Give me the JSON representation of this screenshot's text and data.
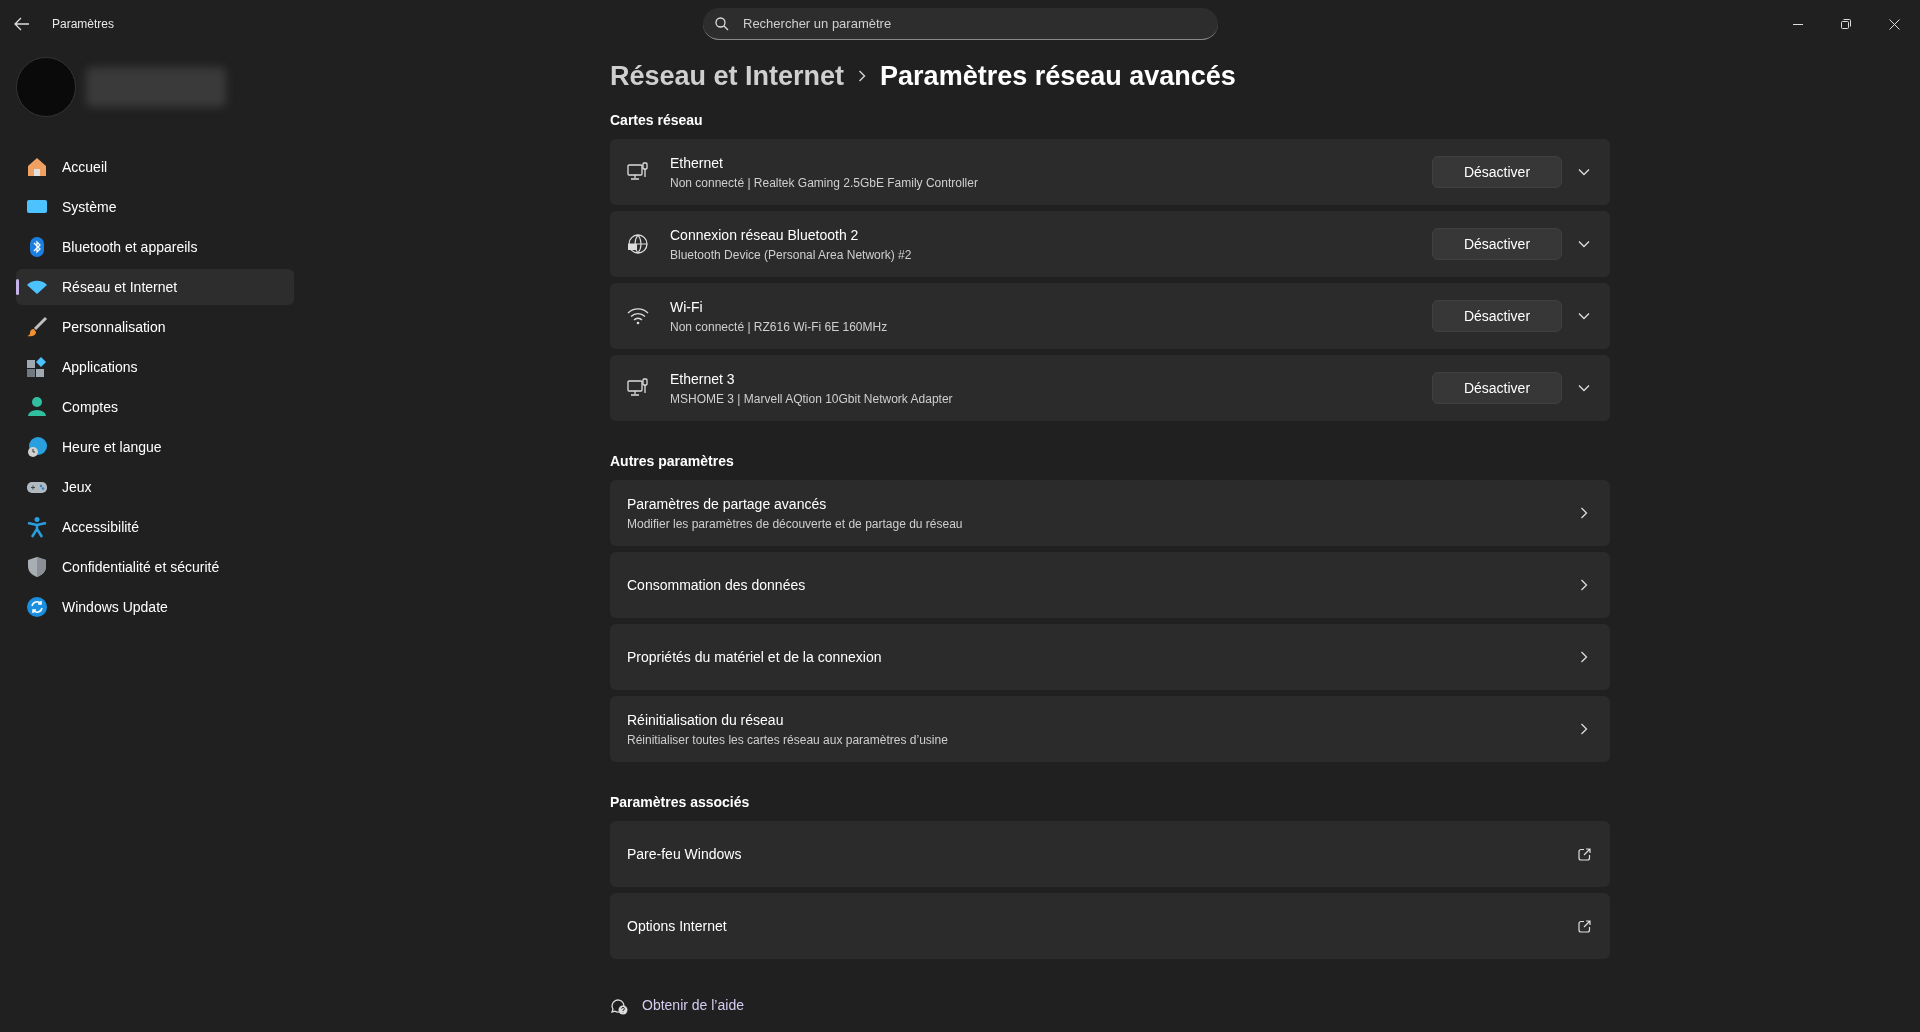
{
  "window": {
    "title": "Paramètres"
  },
  "search": {
    "placeholder": "Rechercher un paramètre"
  },
  "sidebar": {
    "items": [
      {
        "label": "Accueil",
        "selected": false
      },
      {
        "label": "Système",
        "selected": false
      },
      {
        "label": "Bluetooth et appareils",
        "selected": false
      },
      {
        "label": "Réseau et Internet",
        "selected": true
      },
      {
        "label": "Personnalisation",
        "selected": false
      },
      {
        "label": "Applications",
        "selected": false
      },
      {
        "label": "Comptes",
        "selected": false
      },
      {
        "label": "Heure et langue",
        "selected": false
      },
      {
        "label": "Jeux",
        "selected": false
      },
      {
        "label": "Accessibilité",
        "selected": false
      },
      {
        "label": "Confidentialité et sécurité",
        "selected": false
      },
      {
        "label": "Windows Update",
        "selected": false
      }
    ]
  },
  "breadcrumb": [
    "Réseau et Internet",
    "Paramètres réseau avancés"
  ],
  "sections": [
    {
      "heading": "Cartes réseau",
      "items": [
        {
          "kind": "ethernet",
          "title": "Ethernet",
          "subtitle": "Non connecté | Realtek Gaming 2.5GbE Family Controller",
          "button": "Désactiver"
        },
        {
          "kind": "bluetooth",
          "title": "Connexion réseau Bluetooth 2",
          "subtitle": "Bluetooth Device (Personal Area Network) #2",
          "button": "Désactiver"
        },
        {
          "kind": "wifi",
          "title": "Wi-Fi",
          "subtitle": "Non connecté | RZ616 Wi-Fi 6E 160MHz",
          "button": "Désactiver"
        },
        {
          "kind": "ethernet",
          "title": "Ethernet 3",
          "subtitle": "MSHOME 3 | Marvell AQtion 10Gbit Network Adapter",
          "button": "Désactiver"
        }
      ]
    },
    {
      "heading": "Autres paramètres",
      "items": [
        {
          "kind": "link",
          "title": "Paramètres de partage avancés",
          "subtitle": "Modifier les paramètres de découverte et de partage du réseau"
        },
        {
          "kind": "link",
          "title": "Consommation des données"
        },
        {
          "kind": "link",
          "title": "Propriétés du matériel et de la connexion"
        },
        {
          "kind": "link",
          "title": "Réinitialisation du réseau",
          "subtitle": "Réinitialiser toutes les cartes réseau aux paramètres d’usine"
        }
      ]
    },
    {
      "heading": "Paramètres associés",
      "items": [
        {
          "kind": "external",
          "title": "Pare-feu Windows"
        },
        {
          "kind": "external",
          "title": "Options Internet"
        }
      ]
    }
  ],
  "help_link": "Obtenir de l’aide"
}
